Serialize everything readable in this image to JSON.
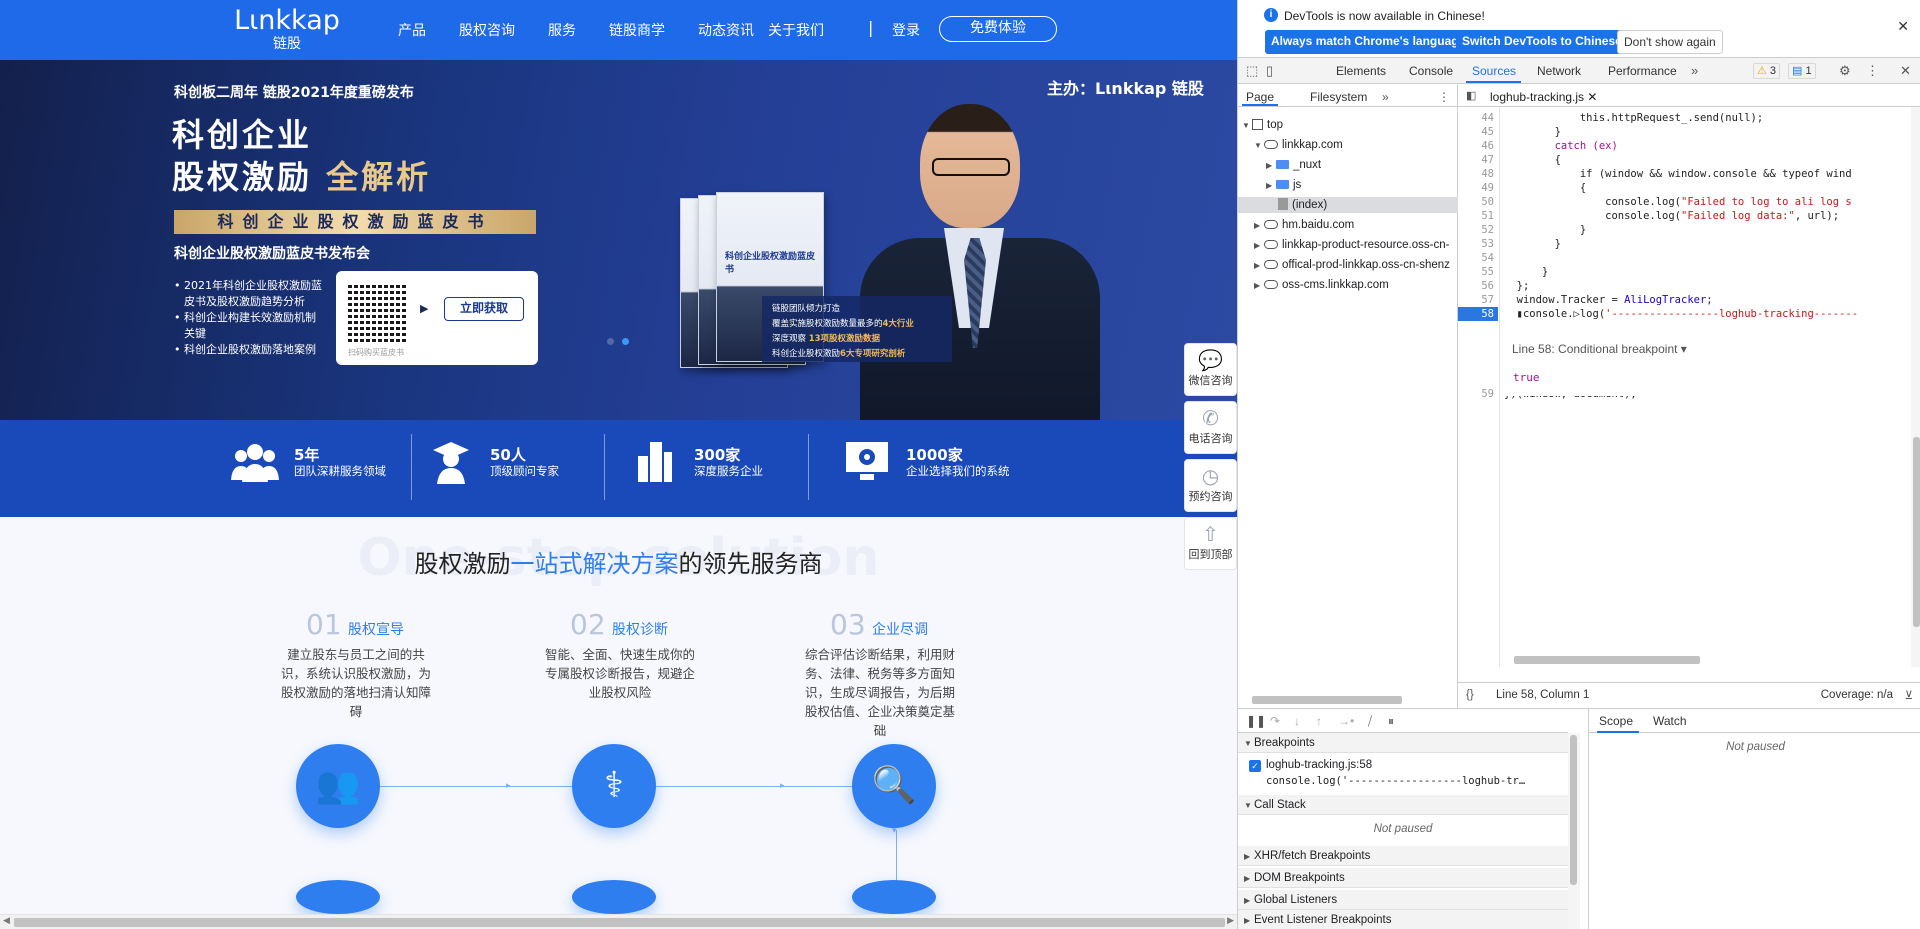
{
  "site": {
    "logo_en": "Lιnkkap",
    "logo_cn": "链股",
    "nav": [
      "产品",
      "股权咨询",
      "服务",
      "链股商学",
      "动态资讯",
      "关于我们"
    ],
    "nav_sep": "|",
    "login": "登录",
    "trial": "免费体验",
    "banner": {
      "sub": "科创板二周年 链股2021年度重磅发布",
      "sponsor": "主办：Lιnkkap 链股",
      "title1": "科创企业",
      "title2_a": "股权激励 ",
      "title2_b": "全解析",
      "ribbon": "科创企业股权激励蓝皮书",
      "conf": "科创企业股权激励蓝皮书发布会",
      "bullets": [
        "2021年科创企业股权激励蓝皮书及股权激励趋势分析",
        "科创企业构建长效激励机制关键",
        "科创企业股权激励落地案例"
      ],
      "qr_caption": "扫码购买蓝皮书",
      "qr_button": "立即获取",
      "book_title": "科创企业股权激励蓝皮书",
      "info_l1": "链股团队倾力打造",
      "info_l2a": "覆盖实施股权激励数量最多的",
      "info_l2b": "4大行业",
      "info_l3a": "深度观察 ",
      "info_l3b": "13项股权激励数据",
      "info_l4a": "科创企业股权激励",
      "info_l4b": "6大专项研究剖析"
    },
    "stats": [
      {
        "num": "5年",
        "label": "团队深耕服务领域"
      },
      {
        "num": "50人",
        "label": "顶级顾问专家"
      },
      {
        "num": "300家",
        "label": "深度服务企业"
      },
      {
        "num": "1000家",
        "label": "企业选择我们的系统"
      }
    ],
    "section_title_a": "股权激励",
    "section_title_hl": "一站式解决方案",
    "section_title_b": "的领先服务商",
    "section_bg": "One-stop solution",
    "steps": [
      {
        "n": "01",
        "title": "股权宣导",
        "desc": "建立股东与员工之间的共识，系统认识股权激励，为股权激励的落地扫清认知障碍"
      },
      {
        "n": "02",
        "title": "股权诊断",
        "desc": "智能、全面、快速生成你的专属股权诊断报告，规避企业股权风险"
      },
      {
        "n": "03",
        "title": "企业尽调",
        "desc": "综合评估诊断结果，利用财务、法律、税务等多方面知识，生成尽调报告，为后期股权估值、企业决策奠定基础"
      }
    ],
    "float": [
      "微信咨询",
      "电话咨询",
      "预约咨询",
      "回到顶部"
    ]
  },
  "devtools": {
    "infobar_msg": "DevTools is now available in Chinese!",
    "btn_match": "Always match Chrome's language",
    "btn_switch": "Switch DevTools to Chinese",
    "btn_dont": "Don't show again",
    "tabs": [
      "Elements",
      "Console",
      "Sources",
      "Network",
      "Performance"
    ],
    "active_tab": "Sources",
    "warn_count": "3",
    "msg_count": "1",
    "subtabs": [
      "Page",
      "Filesystem"
    ],
    "tree": [
      "top",
      "linkkap.com",
      "_nuxt",
      "js",
      "(index)",
      "hm.baidu.com",
      "linkkap-product-resource.oss-cn-",
      "offical-prod-linkkap.oss-cn-shenz",
      "oss-cms.linkkap.com"
    ],
    "file_tab": "loghub-tracking.js",
    "lines": [
      "44",
      "45",
      "46",
      "47",
      "48",
      "49",
      "50",
      "51",
      "52",
      "53",
      "54",
      "55",
      "56",
      "57",
      "58"
    ],
    "line59": "59",
    "code": {
      "l44": "            this.httpRequest_.send(null);",
      "l45": "        }",
      "l46": "        catch (ex)",
      "l47": "        {",
      "l48a": "            if (window && window.console && typeof wind",
      "l49": "            {",
      "l50a": "                console.log(",
      "l50b": "\"Failed to log to ali log s",
      "l51a": "                console.log(",
      "l51b": "\"Failed log data:\"",
      "l51c": ", url);",
      "l52": "            }",
      "l53": "        }",
      "l54": "",
      "l55": "      }",
      "l56": "  };",
      "l57a": "  window.Tracker = ",
      "l57b": "AliLogTracker",
      "l57c": ";",
      "l58a": "  ▮console.▷log(",
      "l58b": "'-----------------loghub-tracking-------",
      "l59": "})(window, document);"
    },
    "cond_label": "Line 58:   Conditional breakpoint ▾",
    "cond_value": "true",
    "status_pos": "Line 58, Column 1",
    "coverage": "Coverage: n/a",
    "sections": [
      "Breakpoints",
      "Call Stack",
      "XHR/fetch Breakpoints",
      "DOM Breakpoints",
      "Global Listeners",
      "Event Listener Breakpoints"
    ],
    "bp_file": "loghub-tracking.js:58",
    "bp_code": "console.log('------------------loghub-tr…",
    "not_paused": "Not paused",
    "scope_tabs": [
      "Scope",
      "Watch"
    ]
  }
}
